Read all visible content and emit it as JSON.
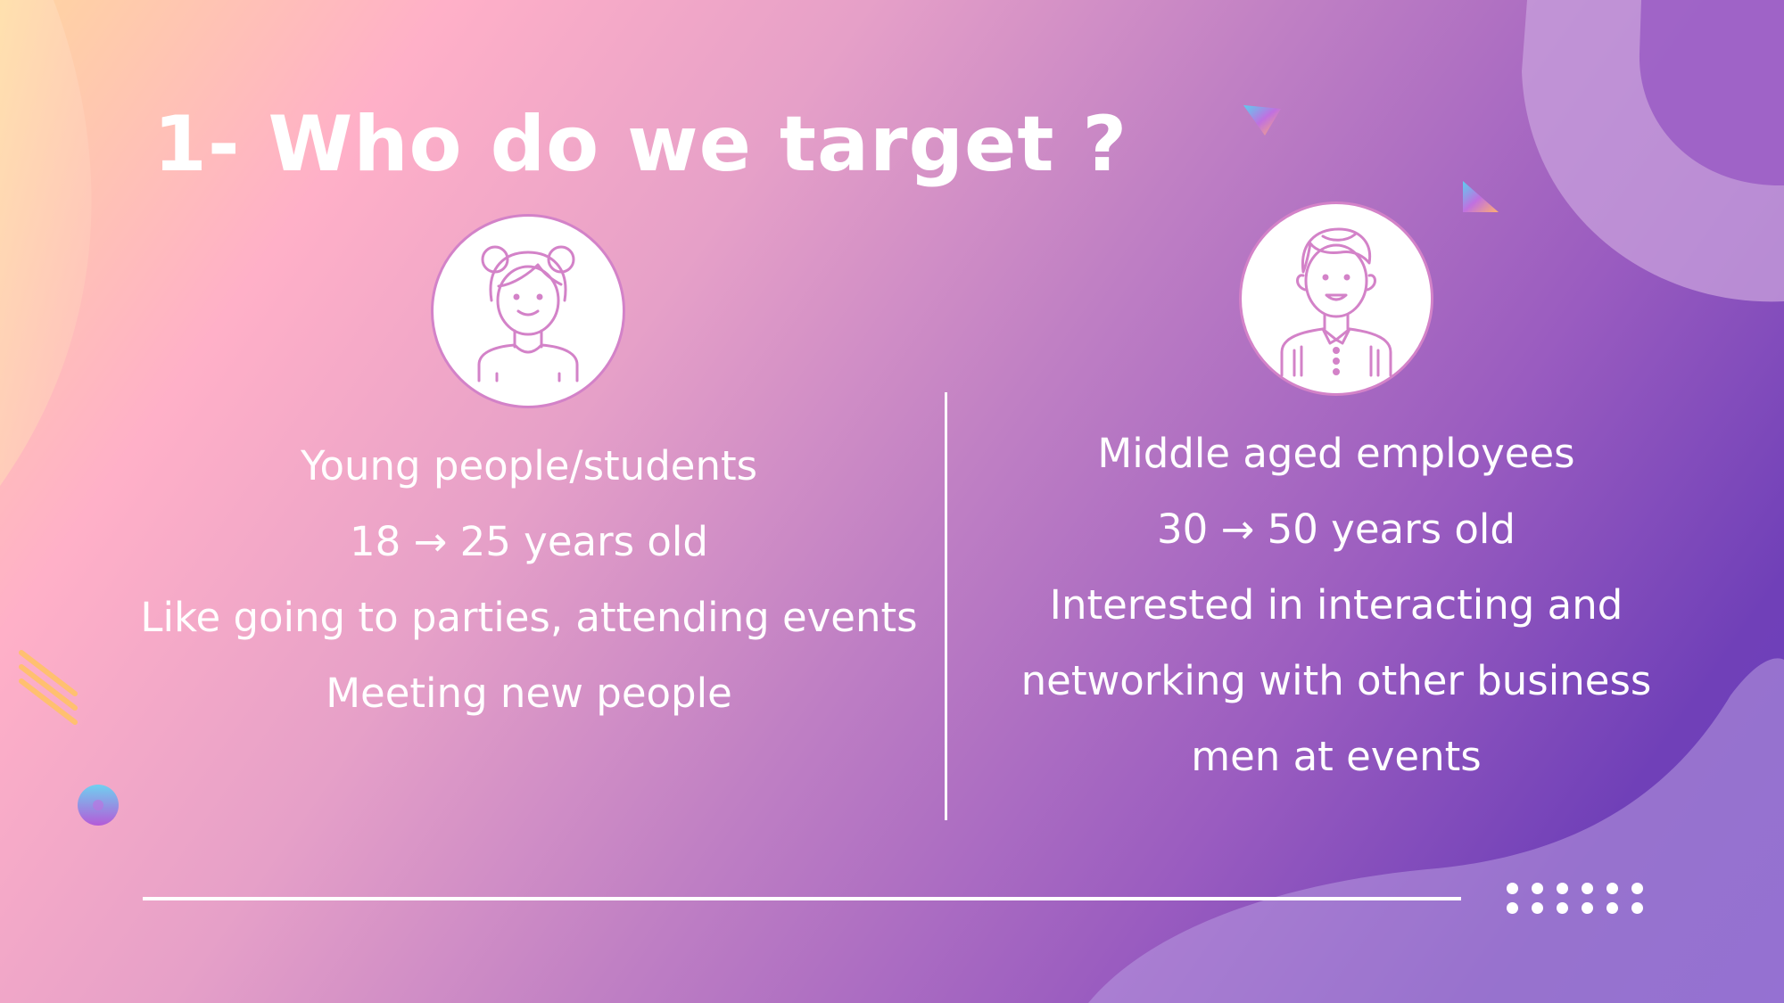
{
  "slide": {
    "title": "1- Who do we target ?",
    "left": {
      "avatar_icon": "young-woman-icon",
      "lines": [
        "Young people/students",
        "18 → 25 years old",
        "Like going to parties, attending events",
        "Meeting new people"
      ]
    },
    "right": {
      "avatar_icon": "middle-aged-man-icon",
      "lines": [
        "Middle aged employees",
        "30 → 50 years old",
        "Interested in interacting and",
        "networking with other business",
        "men at events"
      ]
    },
    "colors": {
      "text": "#ffffff",
      "icon_outline": "#d382c8",
      "gradient_start": "#ffd6a0",
      "gradient_end": "#6a3fc0"
    }
  }
}
